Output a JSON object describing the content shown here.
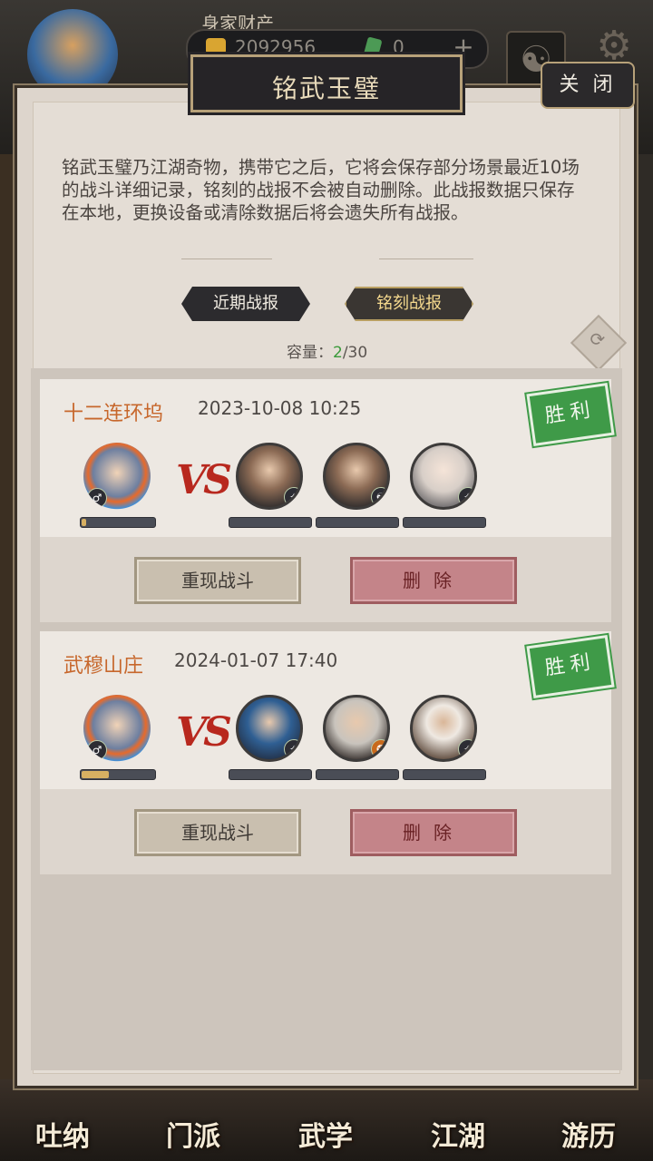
{
  "header": {
    "wealth_label": "身家财产",
    "silver": "2092956",
    "jade": "0",
    "plus": "+"
  },
  "bottom_nav": [
    "吐纳",
    "门派",
    "武学",
    "江湖",
    "游历"
  ],
  "dialog": {
    "title": "铭武玉璧",
    "close_label": "关 闭",
    "description": "铭武玉璧乃江湖奇物，携带它之后，它将会保存部分场景最近10场的战斗详细记录，铭刻的战报不会被自动删除。此战报数据只保存在本地，更换设备或清除数据后将会遗失所有战报。",
    "tabs": [
      {
        "label": "近期战报",
        "active": false
      },
      {
        "label": "铭刻战报",
        "active": true
      }
    ],
    "capacity_label": "容量：",
    "capacity_used": "2",
    "capacity_total": "/30",
    "vs_label": "VS"
  },
  "battles": [
    {
      "location": "十二连环坞",
      "time": "2023-10-08 10:25",
      "result": "胜利",
      "hero_hp_fraction": 0.06,
      "replay_label": "重现战斗",
      "delete_label": "删除"
    },
    {
      "location": "武穆山庄",
      "time": "2024-01-07 17:40",
      "result": "胜利",
      "hero_hp_fraction": 0.38,
      "replay_label": "重现战斗",
      "delete_label": "删除"
    }
  ],
  "colors": {
    "win_stamp": "#3f9a48",
    "location": "#c7672c",
    "delete_button": "#c48489",
    "capacity_used": "#3a9a3a"
  }
}
